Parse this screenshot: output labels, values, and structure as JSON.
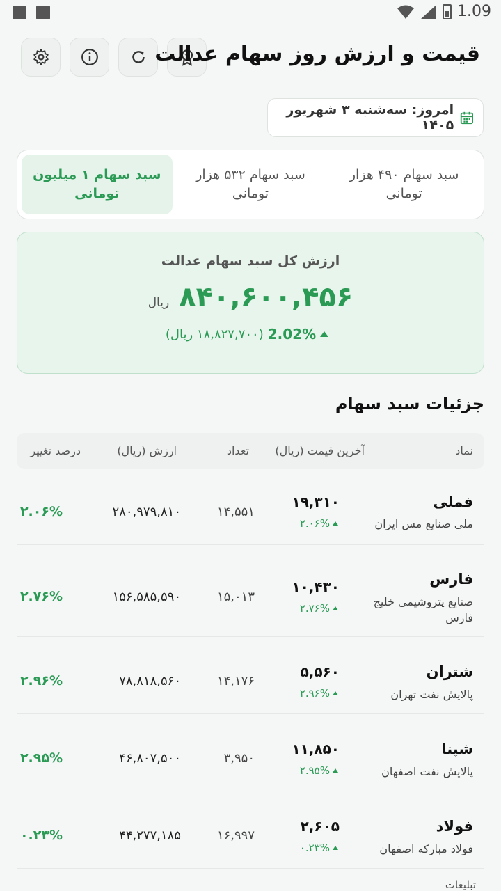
{
  "status_bar": {
    "time": "1.09"
  },
  "header": {
    "title": "قیمت و ارزش روز سهام عدالت"
  },
  "date": {
    "text": "امروز: سه‌شنبه ۳ شهریور ۱۴۰۵"
  },
  "tabs": [
    {
      "label": "سبد سهام ۴۹۰ هزار تومانی",
      "active": false
    },
    {
      "label": "سبد سهام ۵۳۲ هزار تومانی",
      "active": false
    },
    {
      "label": "سبد سهام ۱ میلیون تومانی",
      "active": true
    }
  ],
  "summary": {
    "label": "ارزش کل سبد سهام عدالت",
    "value": "۸۴۰,۶۰۰,۴۵۶",
    "unit": "ریال",
    "change_pct": "2.02%",
    "change_abs": "(۱۸,۸۲۷,۷۰۰ ریال)"
  },
  "section": {
    "title": "جزئیات سبد سهام"
  },
  "table": {
    "headers": {
      "symbol": "نماد",
      "last_price": "آخرین قیمت (ریال)",
      "count": "تعداد",
      "value": "ارزش (ریال)",
      "change": "درصد تغییر"
    },
    "rows": [
      {
        "symbol": "فملی",
        "name": "ملی صنایع مس ایران",
        "price": "۱۹,۳۱۰",
        "price_change": "۲.۰۶%",
        "count": "۱۴,۵۵۱",
        "value": "۲۸۰,۹۷۹,۸۱۰",
        "change": "۲.۰۶%"
      },
      {
        "symbol": "فارس",
        "name": "صنایع پتروشیمی خلیج فارس",
        "price": "۱۰,۴۳۰",
        "price_change": "۲.۷۶%",
        "count": "۱۵,۰۱۳",
        "value": "۱۵۶,۵۸۵,۵۹۰",
        "change": "۲.۷۶%"
      },
      {
        "symbol": "شتران",
        "name": "پالایش نفت تهران",
        "price": "۵,۵۶۰",
        "price_change": "۲.۹۶%",
        "count": "۱۴,۱۷۶",
        "value": "۷۸,۸۱۸,۵۶۰",
        "change": "۲.۹۶%"
      },
      {
        "symbol": "شپنا",
        "name": "پالایش نفت اصفهان",
        "price": "۱۱,۸۵۰",
        "price_change": "۲.۹۵%",
        "count": "۳,۹۵۰",
        "value": "۴۶,۸۰۷,۵۰۰",
        "change": "۲.۹۵%"
      },
      {
        "symbol": "فولاد",
        "name": "فولاد مبارکه اصفهان",
        "price": "۲,۶۰۵",
        "price_change": "۰.۲۳%",
        "count": "۱۶,۹۹۷",
        "value": "۴۴,۲۷۷,۱۸۵",
        "change": "۰.۲۳%"
      }
    ]
  },
  "footer": {
    "note": "تبلیغات"
  },
  "colors": {
    "accent": "#2a9a55",
    "accent_bg": "#e8f5ec"
  },
  "icons": [
    "image-icon",
    "text-icon",
    "wifi-icon",
    "signal-icon",
    "battery-icon",
    "settings-icon",
    "info-icon",
    "refresh-icon",
    "badge-icon",
    "calendar-icon"
  ]
}
